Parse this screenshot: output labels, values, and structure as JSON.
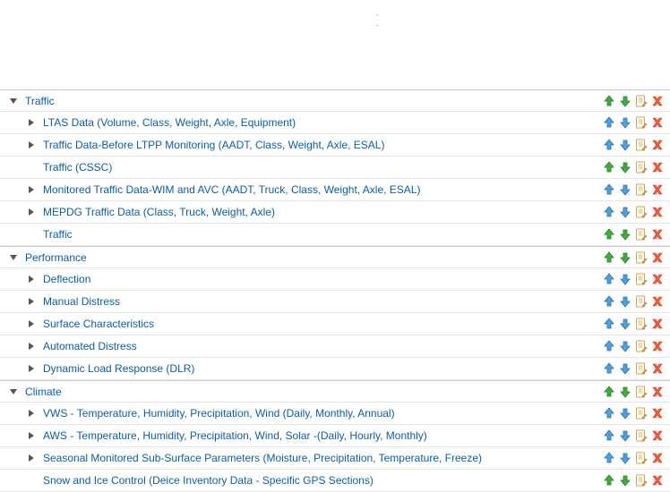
{
  "sections": [
    {
      "label": "Traffic",
      "expanded": true,
      "arrowColor": "green",
      "children": [
        {
          "label": "LTAS Data (Volume, Class, Weight, Axle, Equipment)",
          "hasChildren": true,
          "arrowColor": "blue"
        },
        {
          "label": "Traffic Data-Before LTPP Monitoring (AADT, Class, Weight, Axle, ESAL)",
          "hasChildren": true,
          "arrowColor": "blue"
        },
        {
          "label": "Traffic (CSSC)",
          "hasChildren": false,
          "arrowColor": "green"
        },
        {
          "label": "Monitored Traffic Data-WIM and AVC (AADT, Truck, Class, Weight, Axle, ESAL)",
          "hasChildren": true,
          "arrowColor": "blue"
        },
        {
          "label": "MEPDG Traffic Data (Class, Truck, Weight, Axle)",
          "hasChildren": true,
          "arrowColor": "blue"
        },
        {
          "label": "Traffic",
          "hasChildren": false,
          "arrowColor": "green"
        }
      ]
    },
    {
      "label": "Performance",
      "expanded": true,
      "arrowColor": "green",
      "children": [
        {
          "label": "Deflection",
          "hasChildren": true,
          "arrowColor": "blue"
        },
        {
          "label": "Manual Distress",
          "hasChildren": true,
          "arrowColor": "blue"
        },
        {
          "label": "Surface Characteristics",
          "hasChildren": true,
          "arrowColor": "blue"
        },
        {
          "label": "Automated Distress",
          "hasChildren": true,
          "arrowColor": "blue"
        },
        {
          "label": "Dynamic Load Response (DLR)",
          "hasChildren": true,
          "arrowColor": "blue"
        }
      ]
    },
    {
      "label": "Climate",
      "expanded": true,
      "arrowColor": "green",
      "children": [
        {
          "label": "VWS - Temperature, Humidity, Precipitation, Wind (Daily, Monthly, Annual)",
          "hasChildren": true,
          "arrowColor": "blue"
        },
        {
          "label": "AWS - Temperature, Humidity, Precipitation, Wind, Solar -(Daily, Hourly, Monthly)",
          "hasChildren": true,
          "arrowColor": "blue"
        },
        {
          "label": "Seasonal Monitored Sub-Surface Parameters (Moisture, Precipitation, Temperature, Freeze)",
          "hasChildren": true,
          "arrowColor": "blue"
        },
        {
          "label": "Snow and Ice Control (Deice Inventory Data - Specific GPS Sections)",
          "hasChildren": false,
          "arrowColor": "green"
        }
      ]
    }
  ]
}
